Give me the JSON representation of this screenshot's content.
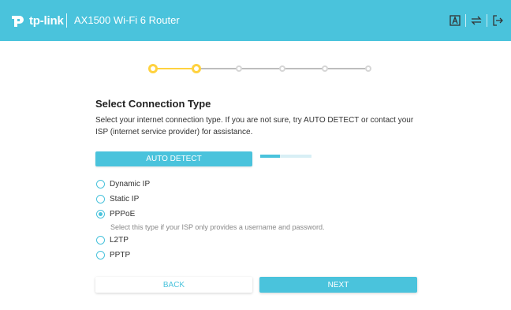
{
  "header": {
    "logo_text": "tp-link",
    "product_title": "AX1500 Wi-Fi 6 Router",
    "icons": [
      "text-size-icon",
      "sync-icon",
      "logout-icon"
    ],
    "bg_color": "#4ac3dc"
  },
  "stepper": {
    "total_steps": 6,
    "completed_steps": 2,
    "active_color": "#ffd23f",
    "inactive_color": "#d6d6d6"
  },
  "main": {
    "title": "Select Connection Type",
    "description": "Select your internet connection type. If you are not sure, try AUTO DETECT or contact your ISP (internet service provider) for assistance.",
    "auto_detect_label": "AUTO DETECT",
    "detect_progress": 0.38,
    "options": [
      {
        "label": "Dynamic IP",
        "checked": false
      },
      {
        "label": "Static IP",
        "checked": false
      },
      {
        "label": "PPPoE",
        "checked": true
      },
      {
        "label": "L2TP",
        "checked": false
      },
      {
        "label": "PPTP",
        "checked": false
      }
    ],
    "pppoe_hint": "Select this type if your ISP only provides a username and password."
  },
  "footer": {
    "back_label": "BACK",
    "next_label": "NEXT"
  },
  "accent_color": "#4ac3dc"
}
